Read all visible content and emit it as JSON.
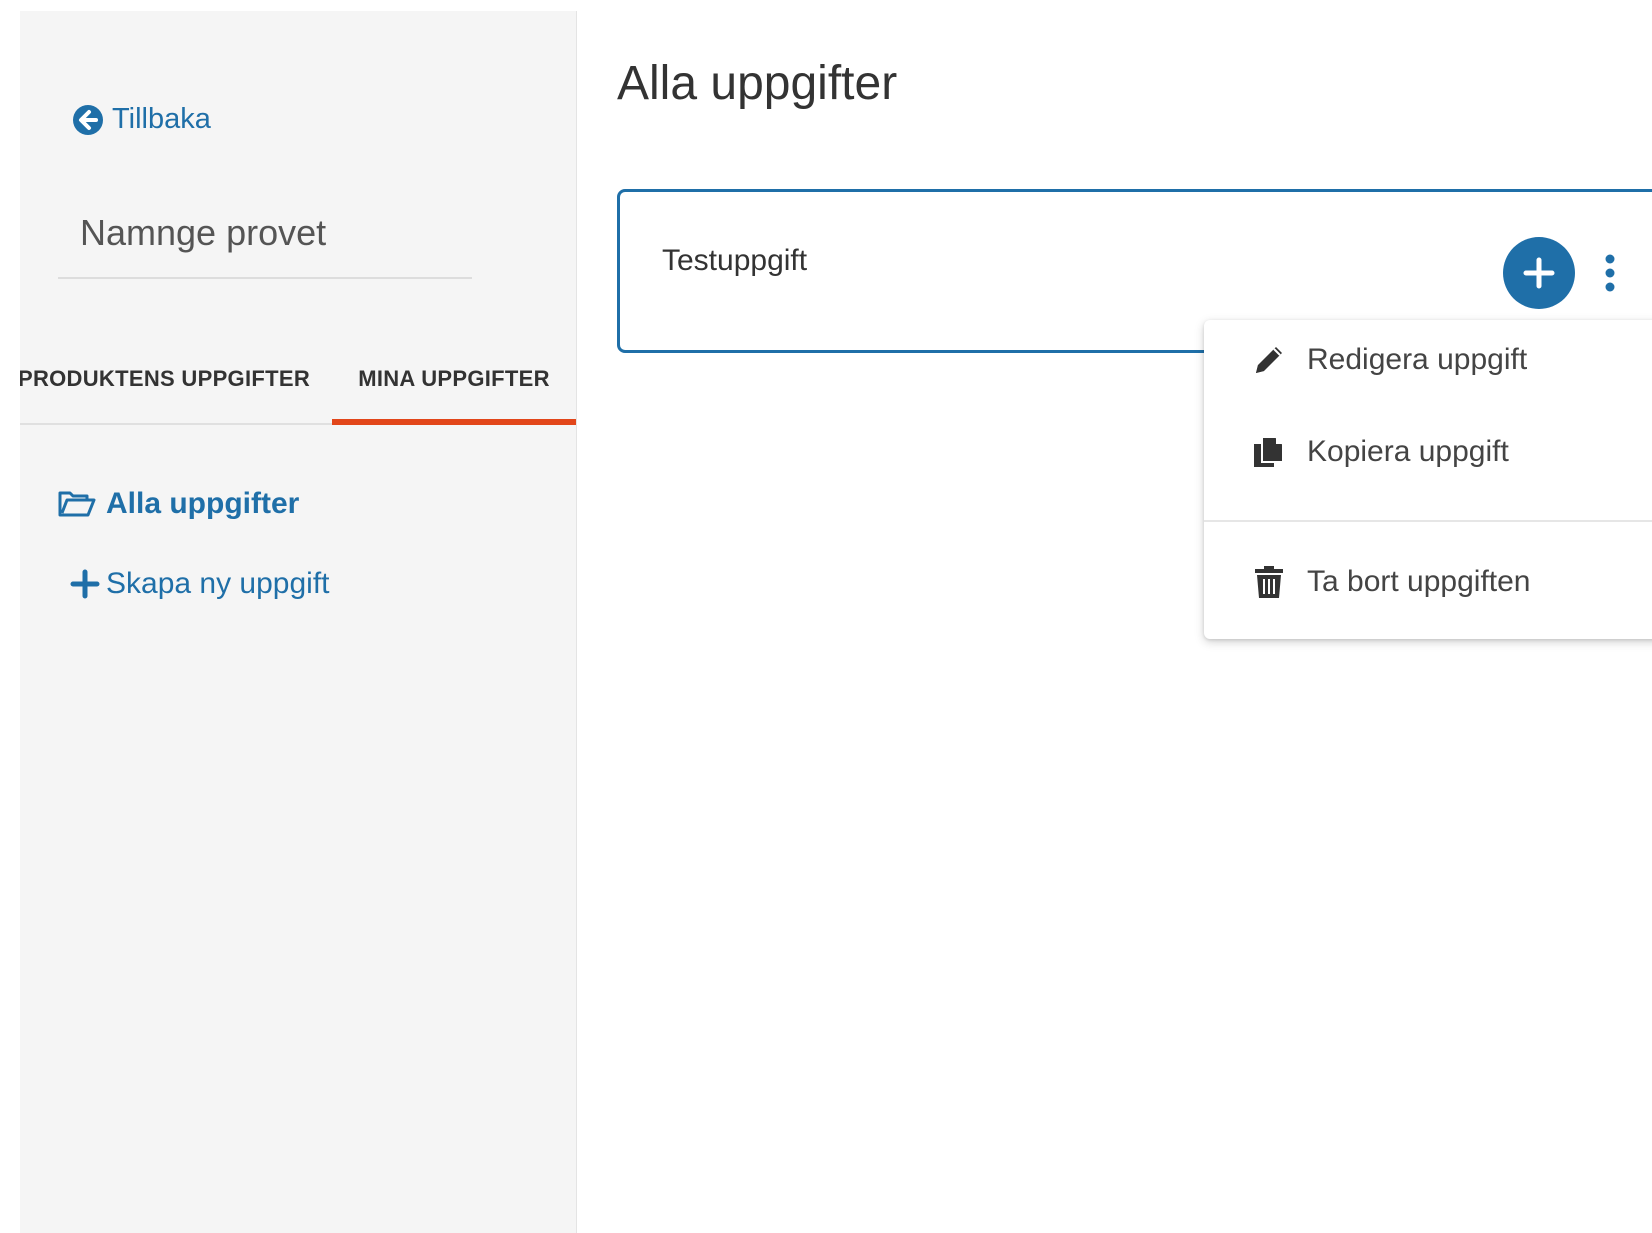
{
  "sidebar": {
    "back_label": "Tillbaka",
    "name_placeholder": "Namnge provet",
    "tabs": [
      {
        "label": "PRODUKTENS UPPGIFTER",
        "active": false
      },
      {
        "label": "MINA UPPGIFTER",
        "active": true
      }
    ],
    "folder_label": "Alla uppgifter",
    "create_label": "Skapa ny uppgift"
  },
  "main": {
    "title": "Alla uppgifter",
    "task": {
      "name": "Testuppgift"
    },
    "menu": {
      "edit_label": "Redigera uppgift",
      "copy_label": "Kopiera uppgift",
      "delete_label": "Ta bort uppgiften"
    }
  },
  "colors": {
    "accent": "#1f6fa8",
    "active_tab_underline": "#e2461a",
    "sidebar_bg": "#f5f5f5"
  },
  "icons": [
    "arrow-circle-left-icon",
    "folder-open-icon",
    "plus-icon",
    "plus-circle-icon",
    "vertical-ellipsis-icon",
    "pencil-icon",
    "copy-icon",
    "trash-icon"
  ]
}
